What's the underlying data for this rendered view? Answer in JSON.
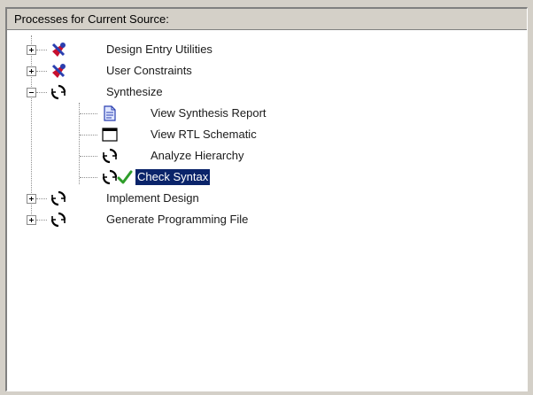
{
  "panel": {
    "title": "Processes for Current Source:"
  },
  "tree": {
    "nodes": [
      {
        "label": "Design Entry Utilities",
        "icon": "tools-icon",
        "expander": "plus"
      },
      {
        "label": "User Constraints",
        "icon": "tools-icon",
        "expander": "plus"
      },
      {
        "label": "Synthesize",
        "icon": "process-icon",
        "expander": "minus",
        "children": [
          {
            "label": "View Synthesis Report",
            "icon": "report-icon"
          },
          {
            "label": "View RTL Schematic",
            "icon": "schematic-window-icon"
          },
          {
            "label": "Analyze Hierarchy",
            "icon": "process-icon"
          },
          {
            "label": "Check Syntax",
            "icon": "process-icon",
            "status": "checkmark-icon",
            "selected": true
          }
        ]
      },
      {
        "label": "Implement Design",
        "icon": "process-icon",
        "expander": "plus"
      },
      {
        "label": "Generate Programming File",
        "icon": "process-icon",
        "expander": "plus"
      }
    ]
  },
  "colors": {
    "selection": "#0a246a",
    "check": "#2e9e2a",
    "tools_red": "#c8102e",
    "tools_blue": "#2a3fb0"
  }
}
